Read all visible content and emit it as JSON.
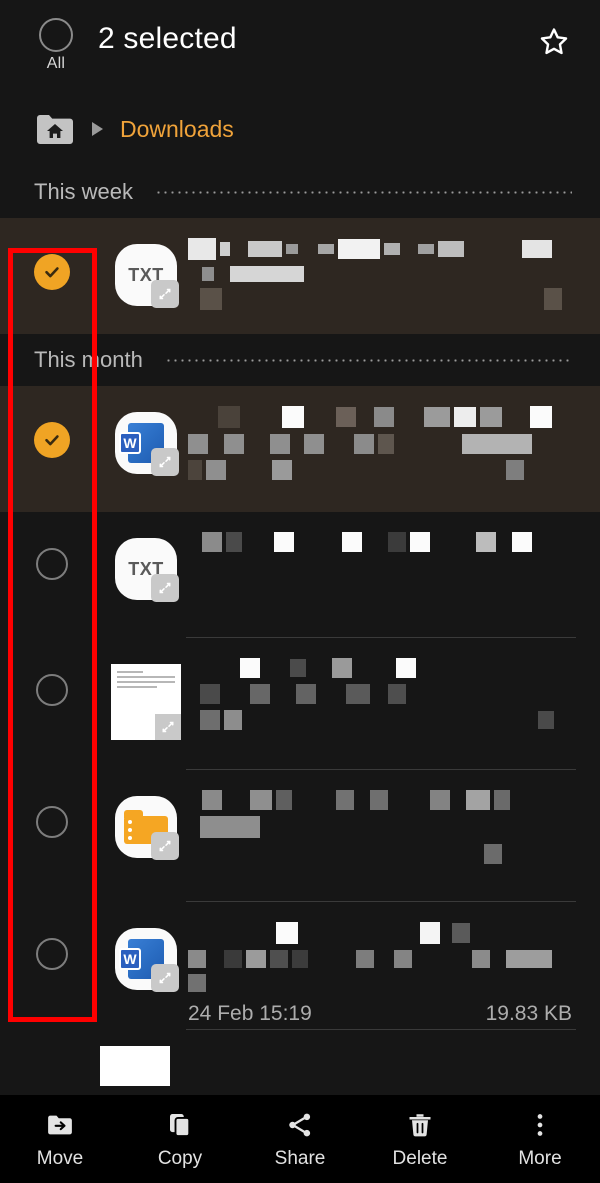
{
  "header": {
    "select_all_label": "All",
    "title": "2 selected",
    "favorite_icon": "star-outline-icon",
    "select_all_icon": "circle-outline-icon"
  },
  "breadcrumb": {
    "home_icon": "home-folder-icon",
    "separator_icon": "caret-right-icon",
    "current_folder": "Downloads"
  },
  "sections": [
    {
      "label": "This week"
    },
    {
      "label": "This month"
    }
  ],
  "rows": [
    {
      "id": "row-1",
      "section": "This week",
      "selected": true,
      "checkbox_icon": "check-circle-filled-icon",
      "file_icon": "txt-file-icon",
      "file_icon_label": "TXT",
      "name_redacted": true,
      "meta_date": "",
      "meta_size": ""
    },
    {
      "id": "row-2",
      "section": "This month",
      "selected": true,
      "checkbox_icon": "check-circle-filled-icon",
      "file_icon": "word-file-icon",
      "file_icon_label": "W",
      "name_redacted": true,
      "meta_date": "",
      "meta_size": ""
    },
    {
      "id": "row-3",
      "section": "This month",
      "selected": false,
      "checkbox_icon": "circle-outline-icon",
      "file_icon": "txt-file-icon",
      "file_icon_label": "TXT",
      "name_redacted": true,
      "meta_date": "",
      "meta_size": ""
    },
    {
      "id": "row-4",
      "section": "This month",
      "selected": false,
      "checkbox_icon": "circle-outline-icon",
      "file_icon": "document-thumbnail-icon",
      "file_icon_label": "",
      "name_redacted": true,
      "meta_date": "",
      "meta_size": ""
    },
    {
      "id": "row-5",
      "section": "This month",
      "selected": false,
      "checkbox_icon": "circle-outline-icon",
      "file_icon": "archive-folder-icon",
      "file_icon_label": "",
      "name_redacted": true,
      "meta_date": "",
      "meta_size": ""
    },
    {
      "id": "row-6",
      "section": "This month",
      "selected": false,
      "checkbox_icon": "circle-outline-icon",
      "file_icon": "word-file-icon",
      "file_icon_label": "W",
      "name_redacted": true,
      "meta_date": "24 Feb 15:19",
      "meta_size": "19.83 KB"
    }
  ],
  "bottom_bar": [
    {
      "label": "Move",
      "icon": "move-folder-arrow-icon"
    },
    {
      "label": "Copy",
      "icon": "copy-pages-icon"
    },
    {
      "label": "Share",
      "icon": "share-nodes-icon"
    },
    {
      "label": "Delete",
      "icon": "trash-bin-icon"
    },
    {
      "label": "More",
      "icon": "kebab-menu-icon"
    }
  ],
  "annotation": {
    "shape": "rectangle",
    "color": "#ff0000",
    "target": "checkbox-column"
  },
  "colors": {
    "background": "#161616",
    "selected_row": "#2e2721",
    "accent": "#f0a424",
    "breadcrumb_link": "#f0a33a",
    "bottom_bar": "#000000",
    "annotation": "#ff0000"
  }
}
